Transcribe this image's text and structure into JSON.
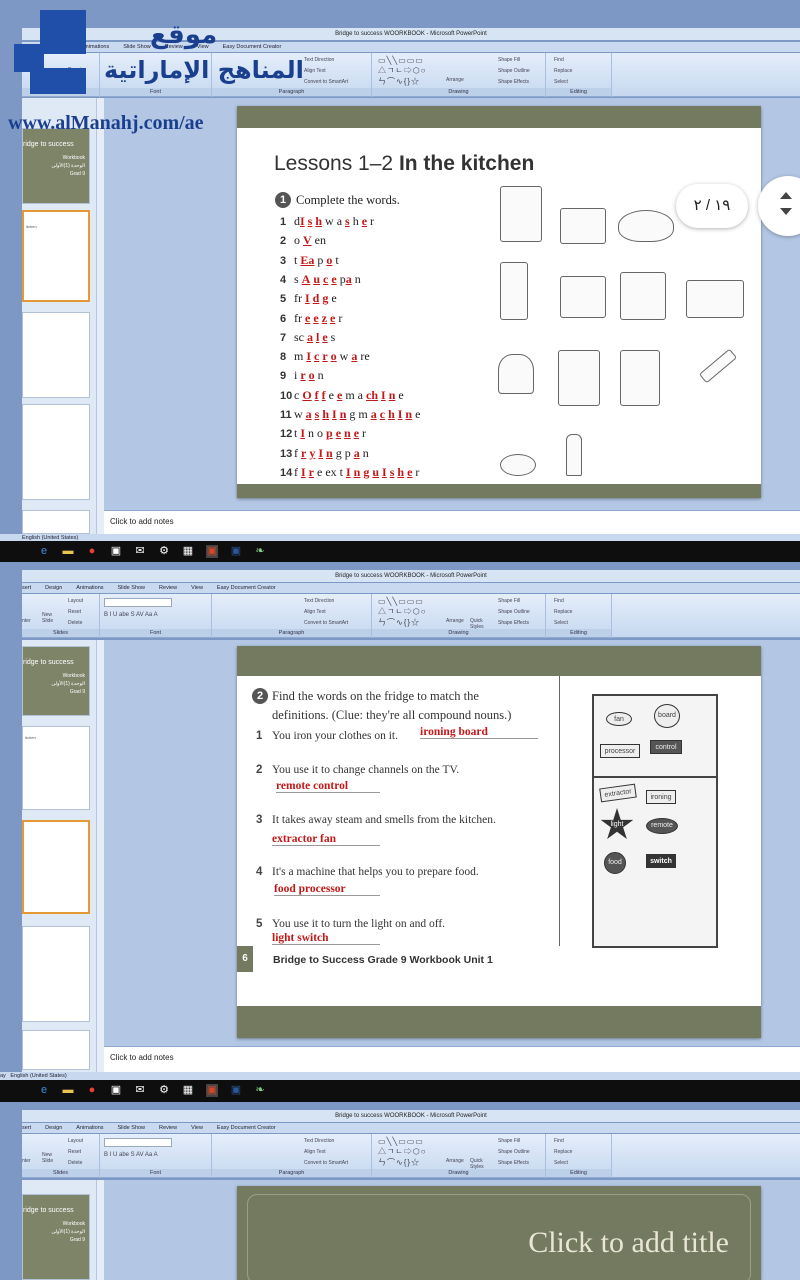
{
  "watermark": {
    "line1": "موقع",
    "line2": "المناهج الإماراتية",
    "url": "www.alManahj.com/ae"
  },
  "window": {
    "title": "Bridge to success WOORKBOOK - Microsoft PowerPoint"
  },
  "tabs": [
    "sert",
    "Design",
    "Animations",
    "Slide Show",
    "Review",
    "View",
    "Easy Document Creator"
  ],
  "ribbon": {
    "slides": {
      "label": "Slides",
      "layout": "Layout",
      "reset": "Reset",
      "delete": "Delete",
      "new_slide": "New Slide",
      "enter": "nter"
    },
    "font": {
      "label": "Font"
    },
    "paragraph": {
      "label": "Paragraph",
      "text_direction": "Text Direction",
      "align_text": "Align Text",
      "convert": "Convert to SmartArt"
    },
    "drawing": {
      "label": "Drawing",
      "arrange": "Arrange",
      "quick_styles": "Quick Styles",
      "fill": "Shape Fill",
      "outline": "Shape Outline",
      "effects": "Shape Effects"
    },
    "editing": {
      "label": "Editing",
      "find": "Find",
      "replace": "Replace",
      "select": "Select"
    }
  },
  "thumbs": {
    "t1_title": "ridge to success",
    "t1_sub": "Workbook",
    "t1_arabic": "الوحدة (1)الأولى",
    "t1_grade": "Grad 9",
    "t2_title": "itchen"
  },
  "page_indicator": "١٩ / ٢",
  "slide1": {
    "heading_light": "Lessons 1–2 ",
    "heading_bold": "In the kitchen",
    "instr_num": "1",
    "instruction": "Complete the words.",
    "rows": [
      {
        "n": "1",
        "parts": [
          [
            "d",
            0
          ],
          [
            "I",
            1
          ],
          [
            " ",
            0
          ],
          [
            "s",
            1
          ],
          [
            " ",
            0
          ],
          [
            "h",
            1
          ],
          [
            " ",
            0
          ],
          [
            "w",
            0
          ],
          [
            " ",
            0
          ],
          [
            "a",
            0
          ],
          [
            " ",
            0
          ],
          [
            "s",
            1
          ],
          [
            " ",
            0
          ],
          [
            "h",
            0
          ],
          [
            " ",
            0
          ],
          [
            "e",
            1
          ],
          [
            " ",
            0
          ],
          [
            "r",
            0
          ]
        ]
      },
      {
        "n": "2",
        "parts": [
          [
            "o",
            0
          ],
          [
            " ",
            0
          ],
          [
            "V",
            1
          ],
          [
            " ",
            0
          ],
          [
            "e",
            0
          ],
          [
            "n",
            0
          ]
        ]
      },
      {
        "n": "3",
        "parts": [
          [
            "t",
            0
          ],
          [
            " ",
            0
          ],
          [
            "Ea",
            1
          ],
          [
            " ",
            0
          ],
          [
            "p",
            0
          ],
          [
            " ",
            0
          ],
          [
            "o",
            1
          ],
          [
            " ",
            0
          ],
          [
            "t",
            0
          ]
        ]
      },
      {
        "n": "4",
        "parts": [
          [
            "s",
            0
          ],
          [
            " ",
            0
          ],
          [
            "A",
            1
          ],
          [
            " ",
            0
          ],
          [
            "u",
            1
          ],
          [
            " ",
            0
          ],
          [
            "c",
            1
          ],
          [
            " ",
            0
          ],
          [
            "e",
            1
          ],
          [
            " ",
            0
          ],
          [
            "p",
            0
          ],
          [
            "a",
            1
          ],
          [
            " ",
            0
          ],
          [
            "n",
            0
          ]
        ]
      },
      {
        "n": "5",
        "parts": [
          [
            "fr",
            0
          ],
          [
            " ",
            0
          ],
          [
            "I",
            1
          ],
          [
            " ",
            0
          ],
          [
            "d",
            1
          ],
          [
            " ",
            0
          ],
          [
            "g",
            1
          ],
          [
            " ",
            0
          ],
          [
            "e",
            0
          ]
        ]
      },
      {
        "n": "6",
        "parts": [
          [
            "fr",
            0
          ],
          [
            " ",
            0
          ],
          [
            "e",
            1
          ],
          [
            " ",
            0
          ],
          [
            "e",
            1
          ],
          [
            " ",
            0
          ],
          [
            "z",
            1
          ],
          [
            " ",
            0
          ],
          [
            "e",
            1
          ],
          [
            " ",
            0
          ],
          [
            "r",
            0
          ]
        ]
      },
      {
        "n": "7",
        "parts": [
          [
            "sc",
            0
          ],
          [
            " ",
            0
          ],
          [
            "a",
            1
          ],
          [
            " ",
            0
          ],
          [
            "l",
            1
          ],
          [
            " ",
            0
          ],
          [
            "e",
            1
          ],
          [
            " ",
            0
          ],
          [
            "s",
            0
          ]
        ]
      },
      {
        "n": "8",
        "parts": [
          [
            "m",
            0
          ],
          [
            " ",
            0
          ],
          [
            "I",
            1
          ],
          [
            " ",
            0
          ],
          [
            "c",
            1
          ],
          [
            " ",
            0
          ],
          [
            "r",
            1
          ],
          [
            " ",
            0
          ],
          [
            "o",
            1
          ],
          [
            " ",
            0
          ],
          [
            "w",
            0
          ],
          [
            " ",
            0
          ],
          [
            "a",
            1
          ],
          [
            " ",
            0
          ],
          [
            "r",
            0
          ],
          [
            "e",
            0
          ]
        ]
      },
      {
        "n": "9",
        "parts": [
          [
            "i",
            0
          ],
          [
            " ",
            0
          ],
          [
            "r",
            1
          ],
          [
            " ",
            0
          ],
          [
            "o",
            1
          ],
          [
            " ",
            0
          ],
          [
            "n",
            0
          ]
        ]
      },
      {
        "n": "10",
        "parts": [
          [
            "c",
            0
          ],
          [
            " ",
            0
          ],
          [
            "O",
            1
          ],
          [
            " ",
            0
          ],
          [
            "f",
            1
          ],
          [
            " ",
            0
          ],
          [
            "f",
            1
          ],
          [
            " ",
            0
          ],
          [
            "e",
            0
          ],
          [
            " ",
            0
          ],
          [
            "e",
            1
          ],
          [
            " ",
            0
          ],
          [
            "m",
            0
          ],
          [
            " ",
            0
          ],
          [
            "a",
            0
          ],
          [
            " ",
            0
          ],
          [
            "c",
            1
          ],
          [
            "h",
            1
          ],
          [
            " ",
            0
          ],
          [
            "I",
            1
          ],
          [
            " ",
            0
          ],
          [
            "n",
            1
          ],
          [
            " ",
            0
          ],
          [
            "e",
            0
          ]
        ]
      },
      {
        "n": "11",
        "parts": [
          [
            "w",
            0
          ],
          [
            " ",
            0
          ],
          [
            "a",
            1
          ],
          [
            " ",
            0
          ],
          [
            "s",
            1
          ],
          [
            " ",
            0
          ],
          [
            "h",
            1
          ],
          [
            " ",
            0
          ],
          [
            "I",
            1
          ],
          [
            " ",
            0
          ],
          [
            "n",
            1
          ],
          [
            " ",
            0
          ],
          [
            "g",
            0
          ],
          [
            " ",
            0
          ],
          [
            "m",
            0
          ],
          [
            " ",
            0
          ],
          [
            "a",
            1
          ],
          [
            " ",
            0
          ],
          [
            "c",
            1
          ],
          [
            " ",
            0
          ],
          [
            "h",
            1
          ],
          [
            " ",
            0
          ],
          [
            "I",
            1
          ],
          [
            " ",
            0
          ],
          [
            "n",
            1
          ],
          [
            " ",
            0
          ],
          [
            "e",
            0
          ]
        ]
      },
      {
        "n": "12",
        "parts": [
          [
            "t",
            0
          ],
          [
            " ",
            0
          ],
          [
            "I",
            1
          ],
          [
            " ",
            0
          ],
          [
            "n",
            0
          ],
          [
            " ",
            0
          ],
          [
            "o",
            0
          ],
          [
            " ",
            0
          ],
          [
            "p",
            1
          ],
          [
            " ",
            0
          ],
          [
            "e",
            1
          ],
          [
            " ",
            0
          ],
          [
            "n",
            1
          ],
          [
            " ",
            0
          ],
          [
            "e",
            1
          ],
          [
            " ",
            0
          ],
          [
            "r",
            0
          ]
        ]
      },
      {
        "n": "13",
        "parts": [
          [
            "f",
            0
          ],
          [
            " ",
            0
          ],
          [
            "r",
            1
          ],
          [
            " ",
            0
          ],
          [
            "y",
            1
          ],
          [
            " ",
            0
          ],
          [
            "I",
            1
          ],
          [
            " ",
            0
          ],
          [
            "n",
            1
          ],
          [
            " ",
            0
          ],
          [
            "g",
            0
          ],
          [
            " ",
            0
          ],
          [
            "p",
            0
          ],
          [
            " ",
            0
          ],
          [
            "a",
            1
          ],
          [
            " ",
            0
          ],
          [
            "n",
            0
          ]
        ]
      },
      {
        "n": "14",
        "parts": [
          [
            "f",
            0
          ],
          [
            " ",
            0
          ],
          [
            "I",
            1
          ],
          [
            " ",
            0
          ],
          [
            "r",
            1
          ],
          [
            " ",
            0
          ],
          [
            "e",
            0
          ],
          [
            " ",
            0
          ],
          [
            "ex",
            0
          ],
          [
            " ",
            0
          ],
          [
            "t",
            0
          ],
          [
            " ",
            0
          ],
          [
            "I",
            1
          ],
          [
            " ",
            0
          ],
          [
            "n",
            1
          ],
          [
            " ",
            0
          ],
          [
            "g",
            1
          ],
          [
            " ",
            0
          ],
          [
            "u",
            1
          ],
          [
            " ",
            0
          ],
          [
            "I",
            1
          ],
          [
            " ",
            0
          ],
          [
            "s",
            1
          ],
          [
            " ",
            0
          ],
          [
            "h",
            1
          ],
          [
            " ",
            0
          ],
          [
            "e",
            1
          ],
          [
            " ",
            0
          ],
          [
            "r",
            0
          ]
        ]
      }
    ]
  },
  "slide2": {
    "num": "2",
    "instruction_l1": "Find the words on the fridge to match the",
    "instruction_l2": "definitions. (Clue: they're all compound nouns.)",
    "items": [
      {
        "n": "1",
        "text": "You iron your clothes on it.",
        "answer": "ironing board"
      },
      {
        "n": "2",
        "text": "You use it to change channels on the TV.",
        "answer": "remote control"
      },
      {
        "n": "3",
        "text": "It takes away steam and smells from the kitchen.",
        "answer": "extractor fan"
      },
      {
        "n": "4",
        "text": "It's a machine that helps you to prepare food.",
        "answer": "food processor"
      },
      {
        "n": "5",
        "text": "You use it to turn the light on and off.",
        "answer": "light switch"
      }
    ],
    "magnets": [
      "fan",
      "board",
      "processor",
      "control",
      "extractor",
      "ironing",
      "light",
      "remote",
      "food",
      "switch"
    ],
    "page_num": "6",
    "footer": "Bridge to Success Grade 9 Workbook Unit 1"
  },
  "slide3": {
    "placeholder": "Click to add title"
  },
  "notes": {
    "placeholder": "Click to add notes"
  },
  "status": {
    "lang": "English (United States)",
    "prefix": "ay"
  }
}
